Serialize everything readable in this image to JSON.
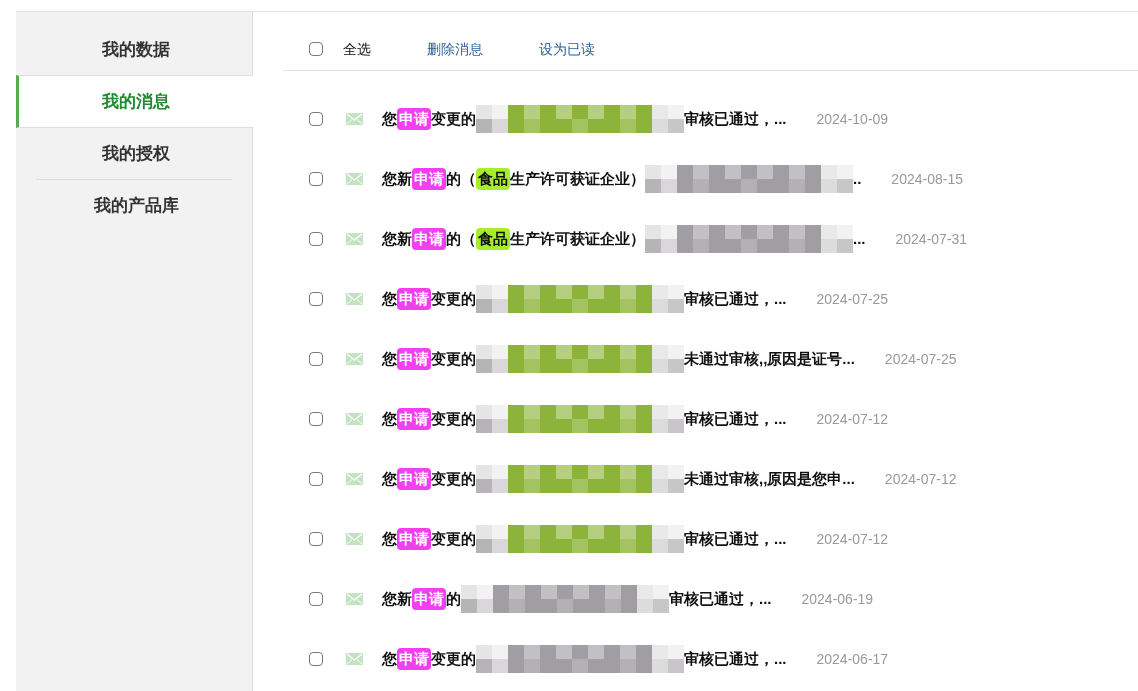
{
  "sidebar": {
    "items": [
      {
        "label": "我的数据",
        "selected": false
      },
      {
        "label": "我的消息",
        "selected": true
      },
      {
        "label": "我的授权",
        "selected": false
      },
      {
        "label": "我的产品库",
        "selected": false
      }
    ]
  },
  "toolbar": {
    "select_all": {
      "label": "全选",
      "checked": false
    },
    "actions": [
      "删除消息",
      "设为已读"
    ]
  },
  "messages": [
    {
      "checked": false,
      "date": "2024-10-09",
      "segments": [
        {
          "kind": "text",
          "text": "您"
        },
        {
          "kind": "highlight",
          "text": "申请",
          "color": "#f23ff2"
        },
        {
          "kind": "text",
          "text": "变更的"
        },
        {
          "kind": "redacted",
          "color": "#8db43a"
        },
        {
          "kind": "text",
          "text": "审核已通过，..."
        }
      ]
    },
    {
      "checked": false,
      "date": "2024-08-15",
      "segments": [
        {
          "kind": "text",
          "text": "您新"
        },
        {
          "kind": "highlight",
          "text": "申请",
          "color": "#f23ff2"
        },
        {
          "kind": "text",
          "text": "的（"
        },
        {
          "kind": "highlight",
          "text": "食品",
          "color": "#a6ee2a"
        },
        {
          "kind": "text",
          "text": "生产许可获证企业）"
        },
        {
          "kind": "redacted",
          "color": "#a19ea3"
        },
        {
          "kind": "text",
          "text": ".."
        }
      ]
    },
    {
      "checked": false,
      "date": "2024-07-31",
      "segments": [
        {
          "kind": "text",
          "text": "您新"
        },
        {
          "kind": "highlight",
          "text": "申请",
          "color": "#f23ff2"
        },
        {
          "kind": "text",
          "text": "的（"
        },
        {
          "kind": "highlight",
          "text": "食品",
          "color": "#a6ee2a"
        },
        {
          "kind": "text",
          "text": "生产许可获证企业）"
        },
        {
          "kind": "redacted",
          "color": "#a19ea3"
        },
        {
          "kind": "text",
          "text": "..."
        }
      ]
    },
    {
      "checked": false,
      "date": "2024-07-25",
      "segments": [
        {
          "kind": "text",
          "text": "您"
        },
        {
          "kind": "highlight",
          "text": "申请",
          "color": "#f23ff2"
        },
        {
          "kind": "text",
          "text": "变更的"
        },
        {
          "kind": "redacted",
          "color": "#8db43a"
        },
        {
          "kind": "text",
          "text": "审核已通过，..."
        }
      ]
    },
    {
      "checked": false,
      "date": "2024-07-25",
      "segments": [
        {
          "kind": "text",
          "text": "您"
        },
        {
          "kind": "highlight",
          "text": "申请",
          "color": "#f23ff2"
        },
        {
          "kind": "text",
          "text": "变更的"
        },
        {
          "kind": "redacted",
          "color": "#8db43a"
        },
        {
          "kind": "text",
          "text": "未通过审核,,原因是证号..."
        }
      ]
    },
    {
      "checked": false,
      "date": "2024-07-12",
      "segments": [
        {
          "kind": "text",
          "text": "您"
        },
        {
          "kind": "highlight",
          "text": "申请",
          "color": "#f23ff2"
        },
        {
          "kind": "text",
          "text": "变更的"
        },
        {
          "kind": "redacted",
          "color": "#8db43a"
        },
        {
          "kind": "text",
          "text": "审核已通过，..."
        }
      ]
    },
    {
      "checked": false,
      "date": "2024-07-12",
      "segments": [
        {
          "kind": "text",
          "text": "您"
        },
        {
          "kind": "highlight",
          "text": "申请",
          "color": "#f23ff2"
        },
        {
          "kind": "text",
          "text": "变更的"
        },
        {
          "kind": "redacted",
          "color": "#8db43a"
        },
        {
          "kind": "text",
          "text": "未通过审核,,原因是您申..."
        }
      ]
    },
    {
      "checked": false,
      "date": "2024-07-12",
      "segments": [
        {
          "kind": "text",
          "text": "您"
        },
        {
          "kind": "highlight",
          "text": "申请",
          "color": "#f23ff2"
        },
        {
          "kind": "text",
          "text": "变更的"
        },
        {
          "kind": "redacted",
          "color": "#8db43a"
        },
        {
          "kind": "text",
          "text": "审核已通过，..."
        }
      ]
    },
    {
      "checked": false,
      "date": "2024-06-19",
      "segments": [
        {
          "kind": "text",
          "text": "您新"
        },
        {
          "kind": "highlight",
          "text": "申请",
          "color": "#f23ff2"
        },
        {
          "kind": "text",
          "text": "的"
        },
        {
          "kind": "redacted",
          "color": "#a19ea3"
        },
        {
          "kind": "text",
          "text": "审核已通过，..."
        }
      ]
    },
    {
      "checked": false,
      "date": "2024-06-17",
      "segments": [
        {
          "kind": "text",
          "text": "您"
        },
        {
          "kind": "highlight",
          "text": "申请",
          "color": "#f23ff2"
        },
        {
          "kind": "text",
          "text": "变更的"
        },
        {
          "kind": "redacted",
          "color": "#a19ea3"
        },
        {
          "kind": "text",
          "text": "审核已通过，..."
        }
      ]
    }
  ]
}
